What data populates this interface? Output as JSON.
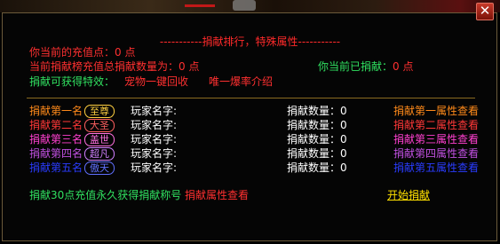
{
  "title": "-----------捐献排行，特殊属性-----------",
  "info": {
    "recharge_label": "你当前的充值点：",
    "recharge_value": "0 点",
    "total_label": "当前捐献榜充值总捐献数量为：",
    "total_value": "0 点",
    "my_label": "你当前已捐献：",
    "my_value": "0 点",
    "effects_label": "捐献可获得特效：",
    "link_recycle": "宠物一键回收",
    "link_intro": "唯一爆率介绍"
  },
  "ranks": [
    {
      "label": "捐献第一名",
      "badge": "至尊",
      "color": "#ff8a1a",
      "badge_color": "#ffd040",
      "player_label": "玩家名字:",
      "amount_label": "捐献数量：",
      "amount": "0",
      "attr_link": "捐献第一属性查看"
    },
    {
      "label": "捐献第二名",
      "badge": "大圣",
      "color": "#ff3838",
      "badge_color": "#ff6060",
      "player_label": "玩家名字:",
      "amount_label": "捐献数量：",
      "amount": "0",
      "attr_link": "捐献第二属性查看"
    },
    {
      "label": "捐献第三名",
      "badge": "盖世",
      "color": "#ff40d0",
      "badge_color": "#ff70e0",
      "player_label": "玩家名字:",
      "amount_label": "捐献数量：",
      "amount": "0",
      "attr_link": "捐献第三属性查看"
    },
    {
      "label": "捐献第四名",
      "badge": "超凡",
      "color": "#c050e0",
      "badge_color": "#d080ff",
      "player_label": "玩家名字:",
      "amount_label": "捐献数量：",
      "amount": "0",
      "attr_link": "捐献第四属性查看"
    },
    {
      "label": "捐献第五名",
      "badge": "傲天",
      "color": "#2a3cff",
      "badge_color": "#6070ff",
      "player_label": "玩家名字:",
      "amount_label": "捐献数量：",
      "amount": "0",
      "attr_link": "捐献第五属性查看"
    }
  ],
  "footer": {
    "title_note": "捐献30点充值永久获得捐献称号",
    "attr_link": "捐献属性查看",
    "start_button": "开始捐献"
  },
  "icons": {
    "close": "close-icon"
  }
}
